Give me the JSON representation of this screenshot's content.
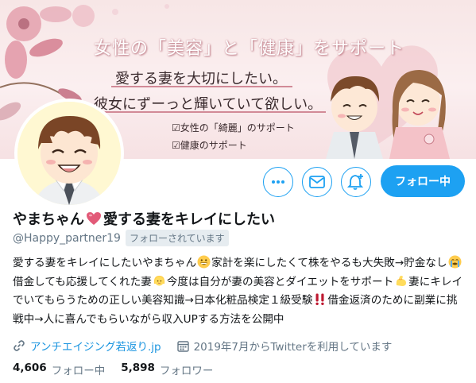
{
  "banner": {
    "line1": "女性の「美容」と「健康」をサポート",
    "line2": "愛する妻を大切にしたい。",
    "line3": "彼女にずーっと輝いていて欲しい。",
    "check1": "☑女性の「綺麗」のサポート",
    "check2": "☑健康のサポート"
  },
  "actions": {
    "follow_label": "フォロー中"
  },
  "profile": {
    "name_part1": "やまちゃん",
    "name_part2": "愛する妻をキレイにしたい",
    "handle": "@Happy_partner19",
    "follows_you": "フォローされています",
    "bio": {
      "t1": "愛する妻をキレイにしたいやまちゃん",
      "t2": "家計を楽にしたくて株をやるも大失敗→貯金なし",
      "t3": "借金しても応援してくれた妻",
      "t4": "今度は自分が妻の美容とダイエットをサポート",
      "t5": "妻にキレイでいてもらうための正しい美容知識→日本化粧品検定１級受験",
      "t6": "借金返済のために副業に挑戦中→人に喜んでもらいながら収入UPする方法を公開中"
    },
    "website": "アンチエイジング若返り.jp",
    "joined": "2019年7月からTwitterを利用しています",
    "following_count": "4,606",
    "following_label": "フォロー中",
    "followers_count": "5,898",
    "followers_label": "フォロワー"
  },
  "colors": {
    "accent": "#1da1f2",
    "link": "#1b95e0",
    "muted": "#657786"
  }
}
